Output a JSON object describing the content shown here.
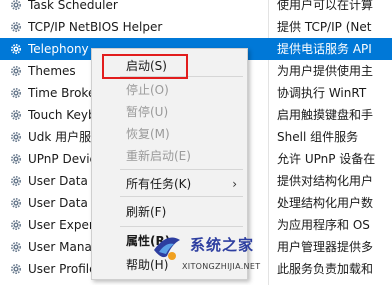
{
  "services": [
    {
      "name": "Task Scheduler",
      "description": "使用户可以在计算"
    },
    {
      "name": "TCP/IP NetBIOS Helper",
      "description": "提供 TCP/IP (Net"
    },
    {
      "name": "Telephony",
      "description": "提供电话服务 API",
      "selected": true
    },
    {
      "name": "Themes",
      "description": "为用户提供使用主"
    },
    {
      "name": "Time Broker",
      "description": "协调执行 WinRT"
    },
    {
      "name": "Touch Keyb",
      "description": "启用触摸键盘和手"
    },
    {
      "name": "Udk 用户服",
      "description": "Shell 组件服务"
    },
    {
      "name": "UPnP Devic",
      "description": "允许 UPnP 设备在"
    },
    {
      "name": "User Data A",
      "description": "提供对结构化用户"
    },
    {
      "name": "User Data S",
      "description": "处理结构化用户数"
    },
    {
      "name": "User Exper",
      "description": "为应用程序和 OS"
    },
    {
      "name": "User Mana",
      "description": "用户管理器提供多"
    },
    {
      "name": "User Profile",
      "description": "此服务负责加载和"
    }
  ],
  "context_menu": {
    "items": [
      {
        "label": "启动(S)",
        "enabled": true,
        "highlighted": true
      },
      {
        "label": "停止(O)",
        "enabled": false
      },
      {
        "label": "暂停(U)",
        "enabled": false
      },
      {
        "label": "恢复(M)",
        "enabled": false
      },
      {
        "label": "重新启动(E)",
        "enabled": false
      },
      {
        "label": "所有任务(K)",
        "enabled": true,
        "submenu": true
      },
      {
        "label": "刷新(F)",
        "enabled": true
      },
      {
        "label": "属性(R)",
        "enabled": true,
        "bold": true
      },
      {
        "label": "帮助(H)",
        "enabled": true
      }
    ],
    "submenu_arrow": "›"
  },
  "watermark": {
    "title": "系统之家",
    "url": "XITONGZHIJIA.NET"
  },
  "colors": {
    "selection": "#0078d7",
    "highlight_box": "#e21d1d",
    "watermark": "#2d3ea0"
  }
}
